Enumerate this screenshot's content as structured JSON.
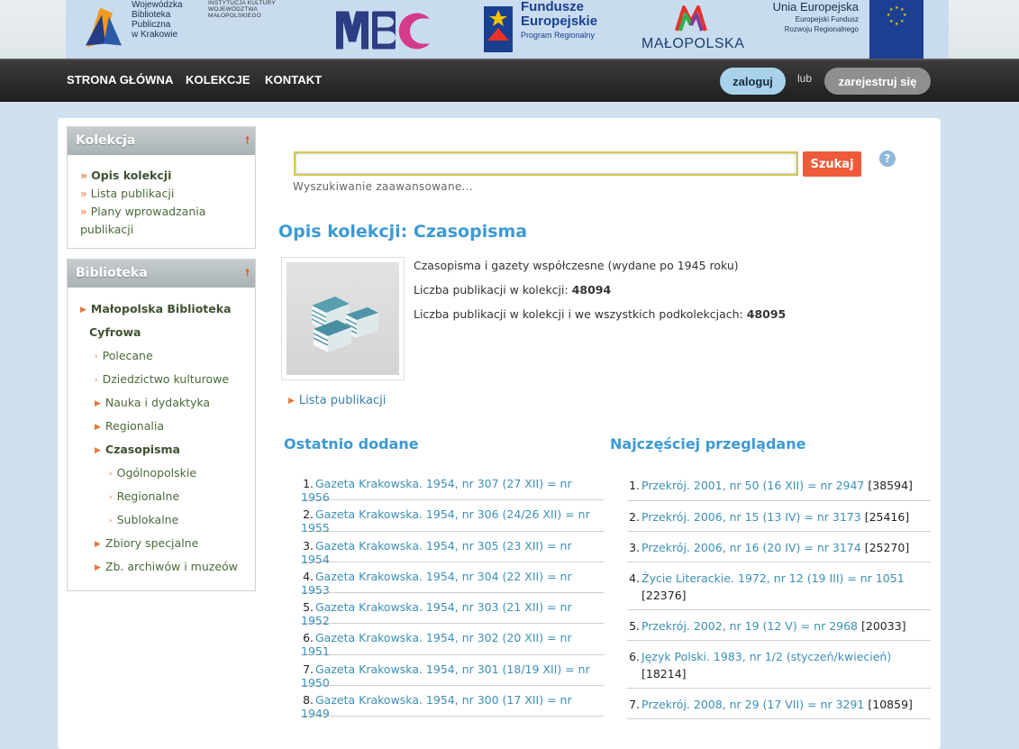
{
  "banner": {
    "wbp_lines": [
      "Wojewódzka",
      "Biblioteka",
      "Publiczna",
      "w Krakowie"
    ],
    "institution_lines": [
      "INSTYTUCJA KULTURY",
      "WOJEWÓDZTWA",
      "MAŁOPOLSKIEGO"
    ],
    "mbc": "MBC",
    "fe_lines": [
      "Fundusze",
      "Europejskie"
    ],
    "fe_sub": "Program Regionalny",
    "malopolska": "MAŁOPOLSKA",
    "eu_title": "Unia Europejska",
    "eu_sub_lines": [
      "Europejski Fundusz",
      "Rozwoju Regionalnego"
    ]
  },
  "nav": {
    "home": "STRONA GŁÓWNA",
    "collections": "KOLEKCJE",
    "contact": "KONTAKT",
    "login": "zaloguj",
    "or": "lub",
    "register": "zarejestruj się"
  },
  "sidebar": {
    "collection": {
      "title": "Kolekcja",
      "items": [
        "Opis kolekcji",
        "Lista publikacji",
        "Plany wprowadzania",
        "publikacji"
      ]
    },
    "library": {
      "title": "Biblioteka",
      "root_line1": "Małopolska Biblioteka",
      "root_line2": "Cyfrowa",
      "items": [
        "Polecane",
        "Dziedzictwo kulturowe",
        "Nauka i dydaktyka",
        "Regionalia",
        "Czasopisma",
        "Ogólnopolskie",
        "Regionalne",
        "Sublokalne",
        "Zbiory specjalne",
        "Zb. archiwów i muzeów"
      ]
    }
  },
  "search": {
    "value": "",
    "button": "Szukaj",
    "help": "?",
    "advanced": "Wyszukiwanie zaawansowane..."
  },
  "main": {
    "title": "Opis kolekcji: Czasopisma",
    "description": "Czasopisma i gazety współczesne (wydane po 1945 roku)",
    "count_label": "Liczba publikacji w kolekcji:",
    "count_value": "48094",
    "count_all_label": "Liczba publikacji w kolekcji i we wszystkich podkolekcjach:",
    "count_all_value": "48095",
    "pub_list_link": "Lista publikacji"
  },
  "recent": {
    "title": "Ostatnio dodane",
    "items": [
      "Gazeta Krakowska. 1954, nr 307 (27 XII) = nr 1956",
      "Gazeta Krakowska. 1954, nr 306 (24/26 XII) = nr 1955",
      "Gazeta Krakowska. 1954, nr 305 (23 XII) = nr 1954",
      "Gazeta Krakowska. 1954, nr 304 (22 XII) = nr 1953",
      "Gazeta Krakowska. 1954, nr 303 (21 XII) = nr 1952",
      "Gazeta Krakowska. 1954, nr 302 (20 XII) = nr 1951",
      "Gazeta Krakowska. 1954, nr 301 (18/19 XII) = nr 1950",
      "Gazeta Krakowska. 1954, nr 300 (17 XII) = nr 1949"
    ]
  },
  "popular": {
    "title": "Najczęściej przeglądane",
    "items": [
      {
        "title": "Przekrój. 2001, nr 50 (16 XII) = nr 2947",
        "views": "[38594]"
      },
      {
        "title": "Przekrój. 2006, nr 15 (13 IV) = nr 3173",
        "views": "[25416]"
      },
      {
        "title": "Przekrój. 2006, nr 16 (20 IV) = nr 3174",
        "views": "[25270]"
      },
      {
        "title": "Życie Literackie. 1972, nr 12 (19 III) = nr 1051",
        "views": "[22376]"
      },
      {
        "title": "Przekrój. 2002, nr 19 (12 V) = nr 2968",
        "views": "[20033]"
      },
      {
        "title": "Język Polski. 1983, nr 1/2 (styczeń/kwiecień)",
        "views": "[18214]"
      },
      {
        "title": "Przekrój. 2008, nr 29 (17 VII) = nr 3291",
        "views": "[10859]"
      }
    ]
  },
  "colors": {
    "accent_blue": "#3c9ad4",
    "search_button": "#ef5a3a",
    "link": "#3c8fb4",
    "nav_bg": "#2a2a2a"
  }
}
